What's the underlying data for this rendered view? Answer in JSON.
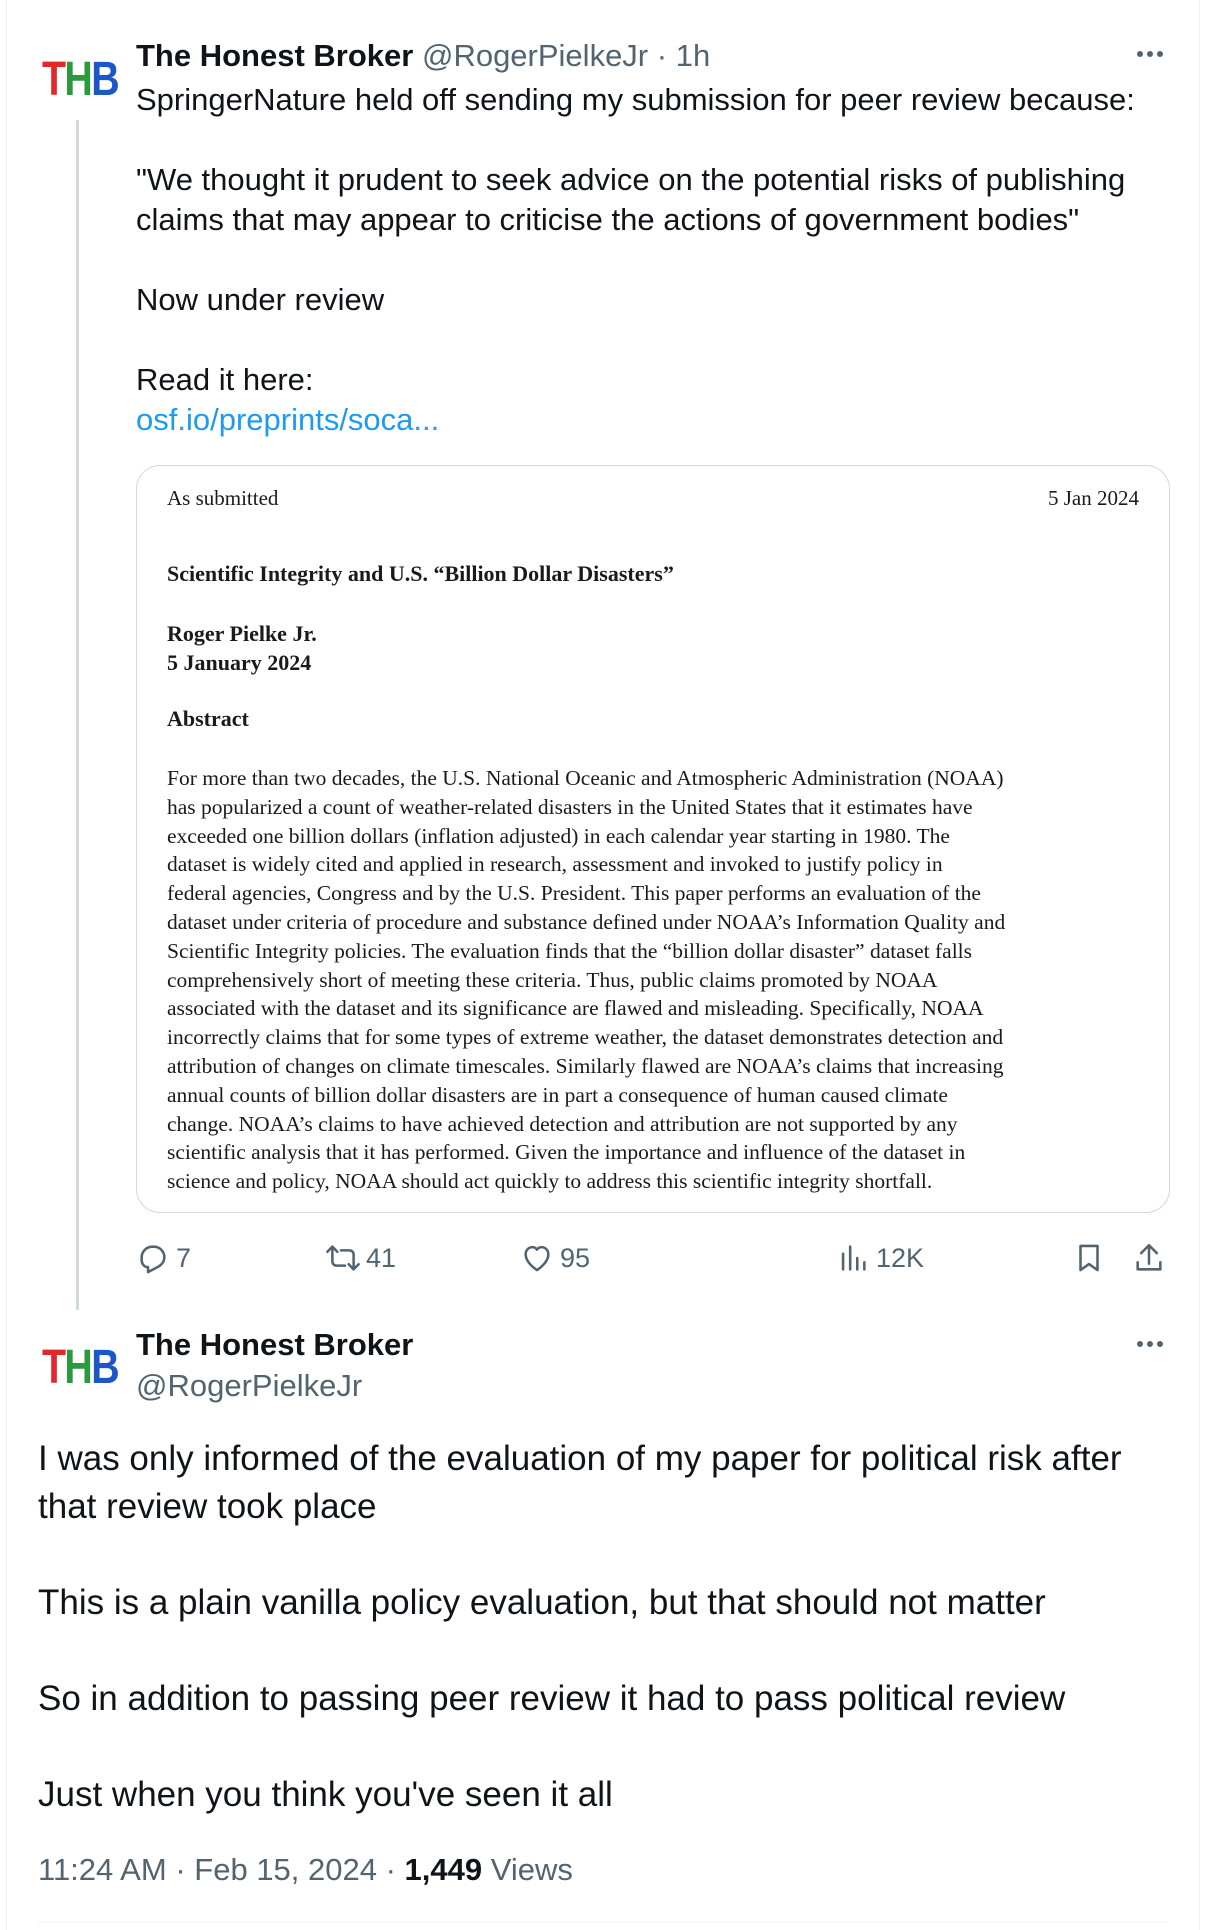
{
  "tweet1": {
    "avatar": {
      "t": "T",
      "h": "H",
      "b": "B"
    },
    "display_name": "The Honest Broker",
    "handle": "@RogerPielkeJr",
    "dot": "·",
    "time": "1h",
    "more_icon": "more-horizontal-icon",
    "body": {
      "line1": "SpringerNature held off sending my submission for peer review because:",
      "quote": "\"We thought it prudent to seek advice on the potential risks of publishing claims that may appear to criticise the actions of government bodies\"",
      "line3": "Now under review",
      "line4": "Read it here:",
      "link": "osf.io/preprints/soca..."
    },
    "card": {
      "sub_left": "As submitted",
      "sub_right": "5 Jan 2024",
      "title": "Scientific Integrity and U.S. “Billion Dollar Disasters”",
      "author": "Roger Pielke Jr.",
      "date": "5 January 2024",
      "abstract_heading": "Abstract",
      "abstract_lines": [
        "For more than two decades, the U.S. National Oceanic and Atmospheric Administration (NOAA)",
        "has popularized a count of weather-related disasters in the United States that it estimates have",
        "exceeded one billion dollars (inflation adjusted) in each calendar year starting in 1980. The",
        "dataset is widely cited and applied in research, assessment and invoked to justify policy in",
        "federal agencies, Congress and by the U.S. President. This paper performs an evaluation of the",
        "dataset under criteria of procedure and substance defined under NOAA’s Information Quality and",
        "Scientific Integrity policies. The evaluation finds that the “billion dollar disaster” dataset falls",
        "comprehensively short of meeting these criteria. Thus, public claims promoted by NOAA",
        "associated with the dataset and its significance are flawed and misleading. Specifically, NOAA",
        "incorrectly claims that for some types of extreme weather, the dataset demonstrates detection and",
        "attribution of changes on climate timescales. Similarly flawed are NOAA’s claims that increasing",
        "annual counts of billion dollar disasters are in part a consequence of human caused climate",
        "change. NOAA’s claims to have achieved detection and attribution are not supported by any",
        "scientific analysis that it has performed. Given the importance and influence of the dataset in",
        "science and policy, NOAA should act quickly to address this scientific integrity shortfall."
      ]
    },
    "actions": {
      "replies": "7",
      "retweets": "41",
      "likes": "95",
      "views": "12K"
    }
  },
  "tweet2": {
    "avatar": {
      "t": "T",
      "h": "H",
      "b": "B"
    },
    "display_name": "The Honest Broker",
    "handle": "@RogerPielkeJr",
    "more_icon": "more-horizontal-icon",
    "paragraphs": [
      "I was only informed of the evaluation of my paper for political risk after that review took place",
      "This is a plain vanilla policy evaluation, but that should not matter",
      "So in addition to passing peer review it had to pass political review",
      "Just when you think you've seen it all"
    ],
    "meta": {
      "time": "11:24 AM",
      "dot": "·",
      "date": "Feb 15, 2024",
      "views_count": "1,449",
      "views_label": "Views"
    }
  },
  "colors": {
    "link": "#1d9bf0",
    "muted": "#536471",
    "text": "#0f1419",
    "avatar_t": "#e0282d",
    "avatar_h": "#2a9a3c",
    "avatar_b": "#1c56c7"
  }
}
